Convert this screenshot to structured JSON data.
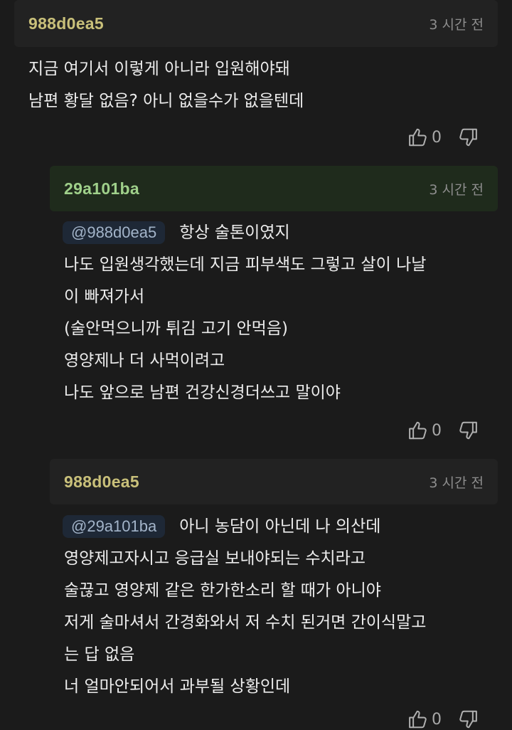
{
  "comments": [
    {
      "author": "988d0ea5",
      "time": "3 시간 전",
      "lines": [
        "지금 여기서 이렇게 아니라 입원해야돼",
        "남편 황달 없음? 아니 없을수가 없을텐데"
      ],
      "likes": "0",
      "author_color": "#c9c07a",
      "header_bg": "#222222"
    },
    {
      "author": "29a101ba",
      "time": "3 시간 전",
      "mention": "@988d0ea5",
      "lines": [
        "항상 술톤이였지",
        "나도 입원생각했는데 지금 피부색도 그렇고 살이 나날",
        "이 빠져가서",
        "(술안먹으니까 튀김 고기 안먹음)",
        "영양제나 더 사먹이려고",
        "나도 앞으로 남편 건강신경더쓰고 말이야"
      ],
      "likes": "0",
      "author_color": "#9fd08a",
      "header_bg": "#1f2b1c"
    },
    {
      "author": "988d0ea5",
      "time": "3 시간 전",
      "mention": "@29a101ba",
      "lines": [
        "아니 농담이 아닌데 나 의산데",
        "영양제고자시고 응급실 보내야되는 수치라고",
        "술끊고 영양제 같은 한가한소리 할 때가 아니야",
        "저게 술마셔서 간경화와서 저 수치 된거면 간이식말고",
        "는 답 없음",
        "너 얼마안되어서 과부될 상황인데"
      ],
      "likes": "0",
      "author_color": "#c9c07a",
      "header_bg": "#222222"
    }
  ],
  "icons": {
    "like": "thumbs-up-icon",
    "dislike": "thumbs-down-icon"
  }
}
